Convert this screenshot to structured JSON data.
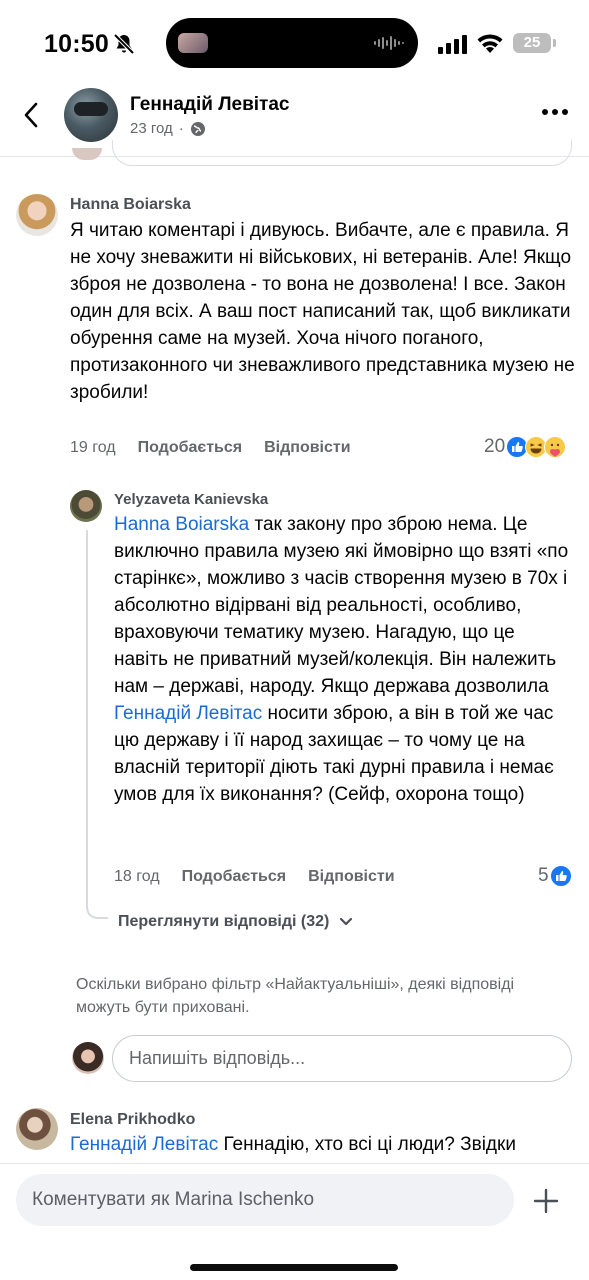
{
  "status_bar": {
    "time": "10:50",
    "battery": "25"
  },
  "header": {
    "name": "Геннадій Левітас",
    "meta_time": "23 год"
  },
  "comments": [
    {
      "author": "Hanna Boiarska",
      "text": "Я читаю коментарі і дивуюсь. Вибачте, але є правила. Я не хочу зневажити ні військових, ні ветеранів. Але! Якщо зброя не дозволена - то вона не дозволена! І все. Закон один для всіх. А ваш пост написаний так, щоб викликати обурення саме на музей. Хоча нічого поганого, протизаконного чи зневажливого представника музею не зробили!",
      "time": "19 год",
      "like_label": "Подобається",
      "reply_label": "Відповісти",
      "reaction_count": "20",
      "reactions": [
        "like-icon",
        "haha-icon",
        "care-icon"
      ]
    },
    {
      "author": "Yelyzaveta Kanievska",
      "mention_1": "Hanna Boiarska",
      "text_1": " так закону про зброю нема. Це виключно правила музею які ймовірно що взяті «по старінкє», можливо з часів створення музею в 70х і абсолютно відірвані від реальності, особливо, враховуючи тематику музею. Нагадую, що це навіть не приватний музей/колекція. Він належить нам – державі, народу. Якщо держава дозволила ",
      "mention_2": "Геннадій Левітас",
      "text_2": " носити зброю, а він в той же час цю державу і її народ захищає – то чому це на власній території діють такі дурні правила і немає умов для їх виконання? (Сейф, охорона тощо)",
      "time": "18 год",
      "like_label": "Подобається",
      "reply_label": "Відповісти",
      "reaction_count": "5",
      "reactions": [
        "like-icon"
      ]
    }
  ],
  "view_replies": "Переглянути відповіді (32)",
  "filter_note": "Оскільки вибрано фільтр «Найактуальніші», деякі відповіді можуть бути приховані.",
  "reply_input": {
    "placeholder": "Напишіть відповідь..."
  },
  "next_comment": {
    "author": "Elena  Prikhodko",
    "mention": "Геннадій Левітас",
    "text": " Геннадію, хто всі ці люди? Звідки"
  },
  "composer": {
    "placeholder": "Коментувати як Marina Ischenko"
  },
  "colors": {
    "mention": "#1b6ad6",
    "like": "#1877f2",
    "secondary_text": "#65676b"
  }
}
